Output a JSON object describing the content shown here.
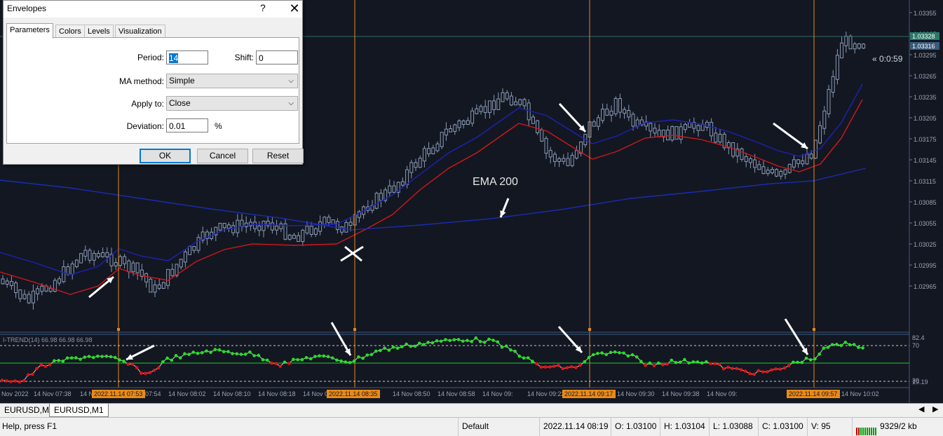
{
  "dialog": {
    "title": "Envelopes",
    "help": "?",
    "close": "✕",
    "tabs": [
      "Parameters",
      "Colors",
      "Levels",
      "Visualization"
    ],
    "period_label": "Period:",
    "period_value": "14",
    "shift_label": "Shift:",
    "shift_value": "0",
    "ma_method_label": "MA method:",
    "ma_method_value": "Simple",
    "apply_to_label": "Apply to:",
    "apply_to_value": "Close",
    "deviation_label": "Deviation:",
    "deviation_value": "0.01",
    "deviation_unit": "%",
    "ok": "OK",
    "cancel": "Cancel",
    "reset": "Reset"
  },
  "chart": {
    "annotation": "EMA 200",
    "countdown": "« 0:0:59",
    "price_labels": [
      "1.03355",
      "1.03325",
      "1.03295",
      "1.03265",
      "1.03235",
      "1.03205",
      "1.03175",
      "1.03145",
      "1.03115",
      "1.03085",
      "1.03055",
      "1.03025",
      "1.02995",
      "1.02965"
    ],
    "price_bid": "1.03328",
    "price_ask": "1.03316",
    "indicator_label": "I-TREND(14) 66.98 66.98 66.98",
    "indicator_levels": [
      "82.4",
      "70",
      "30",
      "19.19"
    ],
    "time_labels": [
      "Nov 2022",
      "14 Nov 07:38",
      "14 N",
      "07:54",
      "14 Nov 08:02",
      "14 Nov 08:10",
      "14 Nov 08:18",
      "14 Nov 08:42",
      "14 Nov 08:50",
      "14 Nov 08:58",
      "14 Nov 09:",
      "14 Nov 09:22",
      "14 Nov 09:30",
      "14 Nov 09:38",
      "14 Nov 09:",
      "14 Nov 10:02"
    ],
    "time_highlights": [
      "2022.11.14 07:53",
      "2022.11.14 08:35",
      "2022.11.14 09:17",
      "2022.11.14 09:57"
    ],
    "colors": {
      "background": "#131722",
      "candle": "#8a9bb4",
      "envelope_upper": "#1e22b4",
      "envelope_lower": "#d01818",
      "ema": "#1a2cb0",
      "vline": "#e08a20",
      "itrend_up": "#22e222",
      "itrend_down": "#e81010",
      "axis_text": "#9aa3b5"
    }
  },
  "symbol_tabs": [
    "EURUSD,M1",
    "EURUSD,M1"
  ],
  "status": {
    "help": "Help, press F1",
    "profile": "Default",
    "datetime": "2022.11.14 08:19",
    "open": "O: 1.03100",
    "high": "H: 1.03104",
    "low": "L: 1.03088",
    "close": "C: 1.03100",
    "volume": "V: 95",
    "traffic": "9329/2 kb"
  }
}
